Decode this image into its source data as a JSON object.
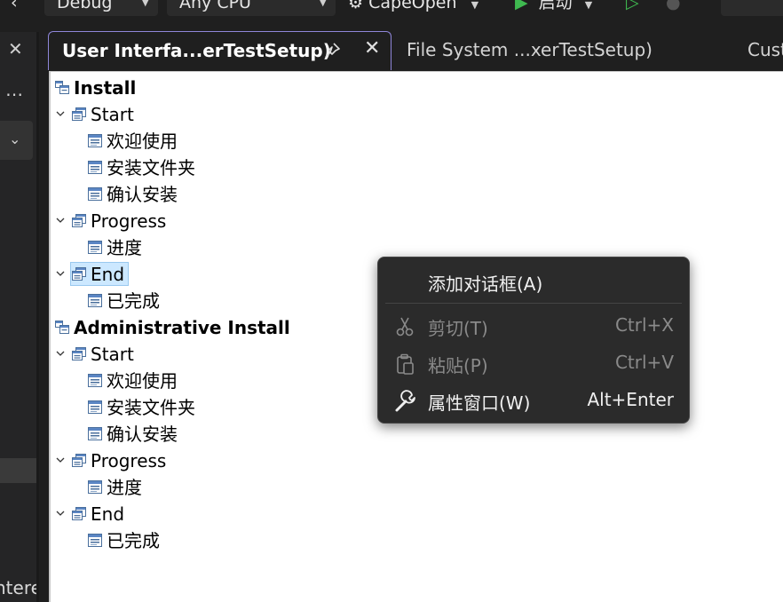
{
  "toolbar": {
    "config": "Debug",
    "platform": "Any CPU",
    "startup_project": "CapeOpen",
    "start_label": "启动"
  },
  "left_panel": {
    "text_fragment": "ntere"
  },
  "tabs": [
    {
      "label": "User Interfa...erTestSetup)",
      "active": true
    },
    {
      "label": "File System ...xerTestSetup)",
      "active": false
    },
    {
      "label": "Cust",
      "active": false
    }
  ],
  "tree": {
    "install": {
      "label": "Install",
      "start": {
        "label": "Start",
        "items": [
          "欢迎使用",
          "安装文件夹",
          "确认安装"
        ]
      },
      "progress": {
        "label": "Progress",
        "items": [
          "进度"
        ]
      },
      "end": {
        "label": "End",
        "items": [
          "已完成"
        ]
      }
    },
    "admin": {
      "label": "Administrative Install",
      "start": {
        "label": "Start",
        "items": [
          "欢迎使用",
          "安装文件夹",
          "确认安装"
        ]
      },
      "progress": {
        "label": "Progress",
        "items": [
          "进度"
        ]
      },
      "end": {
        "label": "End",
        "items": [
          "已完成"
        ]
      }
    },
    "selected": "Install/End"
  },
  "context_menu": {
    "add_dialog": {
      "label": "添加对话框(A)",
      "shortcut": ""
    },
    "cut": {
      "label": "剪切(T)",
      "shortcut": "Ctrl+X",
      "enabled": false,
      "icon": "scissors-icon"
    },
    "paste": {
      "label": "粘贴(P)",
      "shortcut": "Ctrl+V",
      "enabled": false,
      "icon": "clipboard-icon"
    },
    "properties": {
      "label": "属性窗口(W)",
      "shortcut": "Alt+Enter",
      "enabled": true,
      "icon": "wrench-icon"
    }
  },
  "colors": {
    "accent_tab_border": "#8f86d9",
    "selection": "#cce8ff",
    "menu_bg": "#2b2b2b"
  }
}
